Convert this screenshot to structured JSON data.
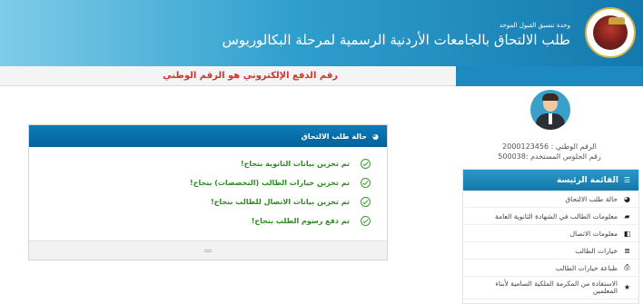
{
  "header": {
    "unit_text": "وحدة تنسيق القبول الموحد",
    "title": "طلب الالتحاق بالجامعات الأردنية الرسمية لمرحلة البكالوريوس"
  },
  "notice": "رقم الدفع الإلكتروني هو الرقم الوطني",
  "profile": {
    "national_number": "الرقم الوطني : 2000123456",
    "seat_number": "رقم الجلوس المستخدم :500038"
  },
  "menu": {
    "title": "القائمة الرئيسة",
    "title_icon": "list-icon",
    "items": [
      {
        "label": "حالة طلب الالتحاق",
        "icon": "pie-chart-icon"
      },
      {
        "label": "معلومات الطالب في الشهادة الثانوية العامة",
        "icon": "graduation-cap-icon"
      },
      {
        "label": "معلومات الاتصال",
        "icon": "phone-icon"
      },
      {
        "label": "خيارات الطالب",
        "icon": "list-icon"
      },
      {
        "label": "طباعة خيارات الطالب",
        "icon": "print-icon"
      },
      {
        "label": "الاستفادة من المكرمة الملكية السامية لأبناء المعلمين",
        "icon": "star-icon"
      }
    ]
  },
  "status_panel": {
    "title": "حالة طلب الالتحاق",
    "title_icon": "pie-chart-icon",
    "items": [
      "تم تخزين بيانات الثانوية بنجاح!",
      "تم تخزين خيارات الطالب (التخصصات) بنجاح!",
      "تم تخزين بيانات الاتصال للطالب بنجاح!",
      "تم دفع رسوم الطلب بنجاح!"
    ]
  },
  "colors": {
    "header_blue": "#1479ad",
    "notice_red": "#d9302e",
    "success_green": "#2e8a22",
    "panel_header": "#0b7db9"
  }
}
